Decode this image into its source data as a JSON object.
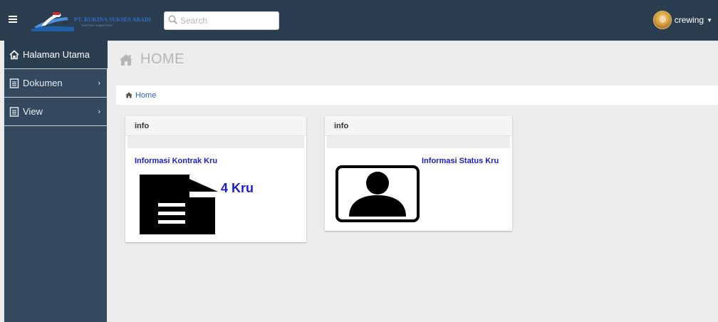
{
  "header": {
    "company_name": "PT. RUKINA SUKSES ABADI",
    "company_sub": "SHIPPING & MARITIME",
    "search_placeholder": "Search",
    "user_name": "crewing"
  },
  "sidebar": {
    "items": [
      {
        "label": "Halaman Utama",
        "icon": "home-icon",
        "active": true
      },
      {
        "label": "Dokumen",
        "icon": "document-icon",
        "chevron": "›"
      },
      {
        "label": "View",
        "icon": "document-icon",
        "chevron": "›"
      }
    ]
  },
  "page": {
    "title": "HOME",
    "breadcrumb": "Home"
  },
  "cards": [
    {
      "header": "info",
      "link": "Informasi Kontrak Kru",
      "count": "4 Kru",
      "icon": "file-icon"
    },
    {
      "header": "info",
      "link": "Informasi Status Kru",
      "icon": "user-card-icon"
    }
  ],
  "colors": {
    "topbar": "#2b3e50",
    "sidebar": "#34495e",
    "link": "#1c1ccf",
    "breadcrumb": "#2a63c6"
  }
}
